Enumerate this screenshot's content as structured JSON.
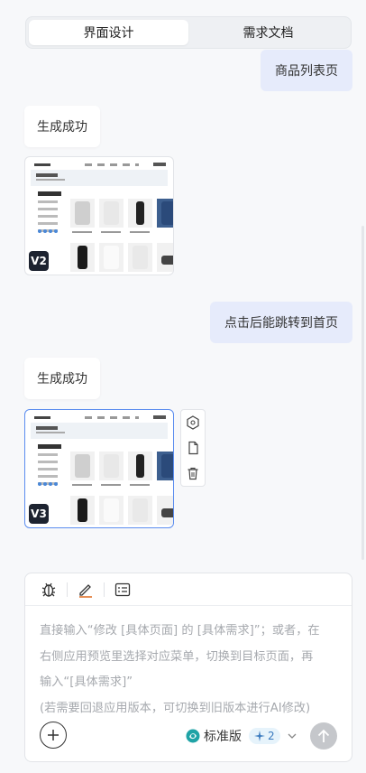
{
  "tabs": [
    {
      "label": "界面设计",
      "active": true
    },
    {
      "label": "需求文档",
      "active": false
    }
  ],
  "messages": {
    "user_1": "商品列表页",
    "ai_1": "生成成功",
    "user_2": "点击后能跳转到首页",
    "ai_2": "生成成功"
  },
  "versions": {
    "v2": "V2",
    "v3": "V3"
  },
  "side_tools": [
    "hexagon-icon",
    "file-icon",
    "trash-icon"
  ],
  "composer": {
    "toolbar": [
      "bug-icon",
      "pen-icon",
      "list-icon"
    ],
    "placeholder_lines": [
      "直接输入“修改 [具体页面] 的 [具体需求]”；或者，在",
      "右侧应用预览里选择对应菜单，切换到目标页面，再",
      "输入“[具体需求]”",
      "(若需要回退应用版本，可切换到旧版本进行AI修改)"
    ],
    "model": "标准版",
    "credits": "2"
  },
  "colors": {
    "accent": "#5b8def",
    "user_bubble": "#e6ebfb"
  }
}
